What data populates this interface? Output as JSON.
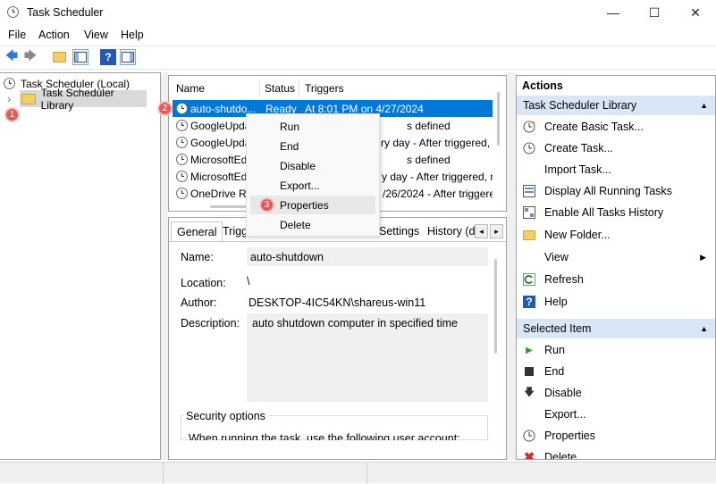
{
  "window": {
    "title": "Task Scheduler",
    "minimize": "—",
    "maximize": "☐",
    "close": "✕"
  },
  "menu": [
    "File",
    "Action",
    "View",
    "Help"
  ],
  "toolbar": {
    "back": "🡄",
    "forward": "🡆",
    "help": "?"
  },
  "tree": {
    "root": "Task Scheduler (Local)",
    "library": "Task Scheduler Library",
    "expander": "›"
  },
  "badges": [
    "1",
    "2",
    "3"
  ],
  "tasks": {
    "columns": [
      "Name",
      "Status",
      "Triggers"
    ],
    "rows": [
      {
        "name": "auto-shutdo...",
        "status": "Ready",
        "triggers": "At 8:01 PM on 4/27/2024",
        "selected": true
      },
      {
        "name": "GoogleUpda",
        "status": "",
        "triggers": "s defined",
        "selected": false
      },
      {
        "name": "GoogleUpda",
        "status": "",
        "triggers": "ry day - After triggered,",
        "selected": false
      },
      {
        "name": "MicrosoftEd",
        "status": "",
        "triggers": "s defined",
        "selected": false
      },
      {
        "name": "MicrosoftEd",
        "status": "",
        "triggers": "y day - After triggered, r",
        "selected": false
      },
      {
        "name": "OneDrive Re",
        "status": "",
        "triggers": "/26/2024 - After triggere",
        "selected": false
      }
    ]
  },
  "context_menu": {
    "items": [
      "Run",
      "End",
      "Disable",
      "Export...",
      "Properties",
      "Delete"
    ],
    "highlighted": "Properties"
  },
  "tabs": {
    "items": [
      "General",
      "Trigg",
      "Settings",
      "History (d"
    ],
    "active": "General",
    "scroll_left": "◂",
    "scroll_right": "▸"
  },
  "general": {
    "name_label": "Name:",
    "name_value": "auto-shutdown",
    "location_label": "Location:",
    "location_value": "\\",
    "author_label": "Author:",
    "author_value": "DESKTOP-4IC54KN\\shareus-win11",
    "description_label": "Description:",
    "description_value": "auto shutdown computer in specified time",
    "security_options": "Security options",
    "security_text": "When running the task, use the following user account:"
  },
  "actions": {
    "title": "Actions",
    "library_section": "Task Scheduler Library",
    "library_items": [
      {
        "label": "Create Basic Task...",
        "icon": "create-basic-task-icon"
      },
      {
        "label": "Create Task...",
        "icon": "create-task-icon"
      },
      {
        "label": "Import Task...",
        "icon": "none"
      },
      {
        "label": "Display All Running Tasks",
        "icon": "running-tasks-icon"
      },
      {
        "label": "Enable All Tasks History",
        "icon": "history-icon"
      },
      {
        "label": "New Folder...",
        "icon": "folder-icon"
      },
      {
        "label": "View",
        "icon": "none"
      },
      {
        "label": "Refresh",
        "icon": "refresh-icon"
      },
      {
        "label": "Help",
        "icon": "help-icon"
      }
    ],
    "selected_section": "Selected Item",
    "selected_items": [
      {
        "label": "Run",
        "icon": "run-icon"
      },
      {
        "label": "End",
        "icon": "end-icon"
      },
      {
        "label": "Disable",
        "icon": "disable-icon"
      },
      {
        "label": "Export...",
        "icon": "none"
      },
      {
        "label": "Properties",
        "icon": "properties-icon"
      },
      {
        "label": "Delete",
        "icon": "delete-icon"
      }
    ],
    "collapse_glyph": "▲",
    "submenu_glyph": "▶"
  },
  "colors": {
    "selection": "#0078d7",
    "section_header": "#d9e6f6",
    "badge": "#e05a5a"
  }
}
